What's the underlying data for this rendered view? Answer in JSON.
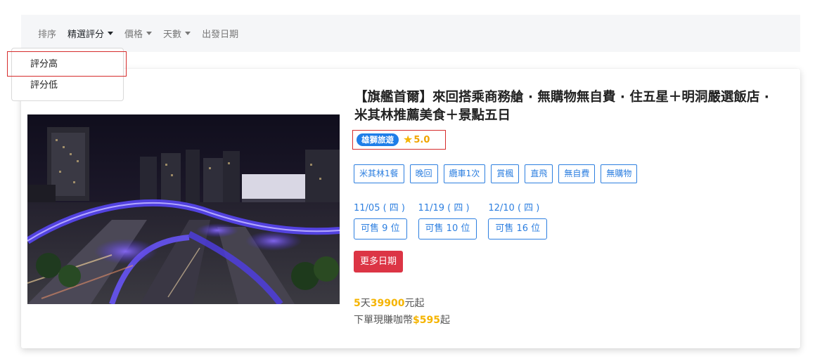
{
  "filter_bar": {
    "items": [
      {
        "label": "排序",
        "has_caret": false
      },
      {
        "label": "精選評分",
        "has_caret": true
      },
      {
        "label": "價格",
        "has_caret": true
      },
      {
        "label": "天數",
        "has_caret": true
      },
      {
        "label": "出發日期",
        "has_caret": false
      }
    ]
  },
  "dropdown": {
    "items": [
      "評分高",
      "評分低"
    ]
  },
  "tour": {
    "title": "【旗艦首爾】來回搭乘商務艙 · 無購物無自費 · 住五星＋明洞嚴選飯店 · 米其林推薦美食＋景點五日",
    "agency": "雄獅旅遊",
    "star_icon": "star-icon",
    "rating": "5.0",
    "tags": [
      "米其林1餐",
      "晚回",
      "纜車1次",
      "賞楓",
      "直飛",
      "無自費",
      "無購物"
    ],
    "departures": [
      {
        "date": "11/05 ( 四 )",
        "seats": "可售 9 位"
      },
      {
        "date": "11/19 ( 四 )",
        "seats": "可售 10 位"
      },
      {
        "date": "12/10 ( 四 )",
        "seats": "可售 16 位"
      }
    ],
    "more_dates_label": "更多日期",
    "price": {
      "days": "5",
      "days_unit": "天",
      "amount": "39900",
      "suffix": "元起"
    },
    "points": {
      "prefix": "下單現賺咖幣",
      "amount": "$595",
      "suffix": "起"
    }
  },
  "colors": {
    "accent": "#2d7fe0",
    "badge": "#1f7ee8",
    "danger": "#dc3545",
    "gold": "#f5b400",
    "highlight": "#d62c2c"
  }
}
